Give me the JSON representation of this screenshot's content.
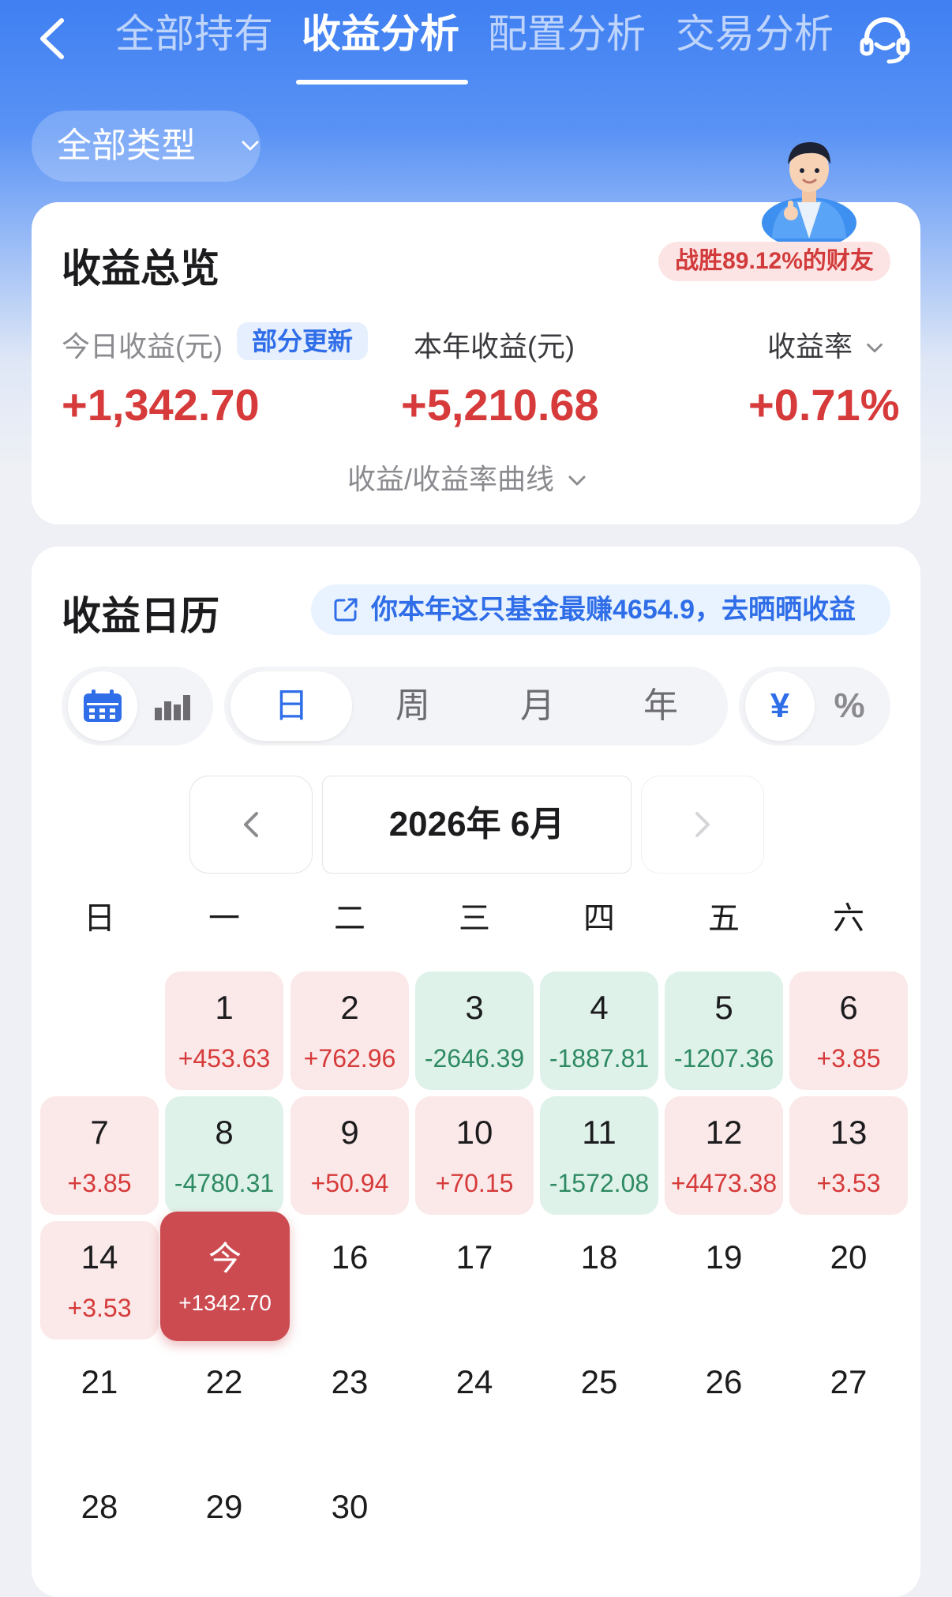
{
  "header": {
    "tabs": [
      "全部持有",
      "收益分析",
      "配置分析",
      "交易分析"
    ],
    "active_tab": "收益分析",
    "icons": [
      "chevron-left-icon",
      "customer-service-icon"
    ]
  },
  "filter": {
    "label": "全部类型"
  },
  "summary": {
    "title": "收益总览",
    "beat_badge": "战胜89.12%的财友",
    "today_label": "今日收益(元)",
    "today_badge": "部分更新",
    "year_label": "本年收益(元)",
    "rate_label": "收益率",
    "today_value": "+1,342.70",
    "year_value": "+5,210.68",
    "rate_value": "+0.71%",
    "curve_link": "收益/收益率曲线"
  },
  "calendar": {
    "title": "收益日历",
    "promo": "你本年这只基金最赚4654.9，去晒晒收益",
    "periods": [
      "日",
      "周",
      "月",
      "年"
    ],
    "active_period": "日",
    "units": [
      "¥",
      "%"
    ],
    "active_unit": "¥",
    "month": "2026年 6月",
    "weekdays": [
      "日",
      "一",
      "二",
      "三",
      "四",
      "五",
      "六"
    ],
    "today_label": "今",
    "days": [
      {
        "d": "1",
        "v": "+453.63",
        "t": "up"
      },
      {
        "d": "2",
        "v": "+762.96",
        "t": "up"
      },
      {
        "d": "3",
        "v": "-2646.39",
        "t": "dn"
      },
      {
        "d": "4",
        "v": "-1887.81",
        "t": "dn"
      },
      {
        "d": "5",
        "v": "-1207.36",
        "t": "dn"
      },
      {
        "d": "6",
        "v": "+3.85",
        "t": "up"
      },
      {
        "d": "7",
        "v": "+3.85",
        "t": "up"
      },
      {
        "d": "8",
        "v": "-4780.31",
        "t": "dn"
      },
      {
        "d": "9",
        "v": "+50.94",
        "t": "up"
      },
      {
        "d": "10",
        "v": "+70.15",
        "t": "up"
      },
      {
        "d": "11",
        "v": "-1572.08",
        "t": "dn"
      },
      {
        "d": "12",
        "v": "+4473.38",
        "t": "up"
      },
      {
        "d": "13",
        "v": "+3.53",
        "t": "up"
      },
      {
        "d": "14",
        "v": "+3.53",
        "t": "up"
      },
      {
        "d": "今",
        "v": "+1342.70",
        "t": "today"
      },
      {
        "d": "16",
        "v": "",
        "t": "plain"
      },
      {
        "d": "17",
        "v": "",
        "t": "plain"
      },
      {
        "d": "18",
        "v": "",
        "t": "plain"
      },
      {
        "d": "19",
        "v": "",
        "t": "plain"
      },
      {
        "d": "20",
        "v": "",
        "t": "plain"
      },
      {
        "d": "21",
        "v": "",
        "t": "plain"
      },
      {
        "d": "22",
        "v": "",
        "t": "plain"
      },
      {
        "d": "23",
        "v": "",
        "t": "plain"
      },
      {
        "d": "24",
        "v": "",
        "t": "plain"
      },
      {
        "d": "25",
        "v": "",
        "t": "plain"
      },
      {
        "d": "26",
        "v": "",
        "t": "plain"
      },
      {
        "d": "27",
        "v": "",
        "t": "plain"
      },
      {
        "d": "28",
        "v": "",
        "t": "plain"
      },
      {
        "d": "29",
        "v": "",
        "t": "plain"
      },
      {
        "d": "30",
        "v": "",
        "t": "plain"
      }
    ]
  },
  "colors": {
    "primary": "#3f7ff2",
    "gain": "#d63a3a",
    "loss": "#2e8a62",
    "today": "#cc4b50"
  }
}
